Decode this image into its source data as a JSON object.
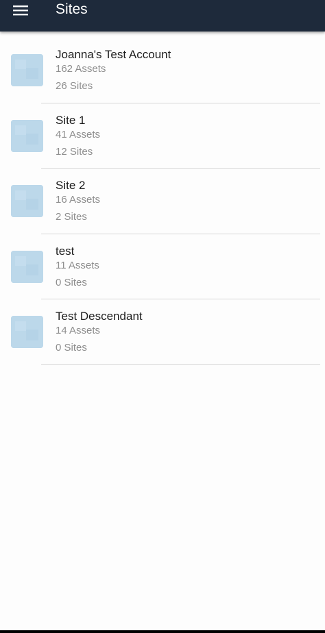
{
  "header": {
    "title": "Sites",
    "menu_icon": "hamburger-menu-icon",
    "background_color": "#1e2a3b"
  },
  "sites": [
    {
      "name": "Joanna's Test Account",
      "assets": "162 Assets",
      "sites": "26 Sites"
    },
    {
      "name": "Site 1",
      "assets": "41 Assets",
      "sites": "12 Sites"
    },
    {
      "name": "Site 2",
      "assets": "16 Assets",
      "sites": "2 Sites"
    },
    {
      "name": "test",
      "assets": "11 Assets",
      "sites": "0 Sites"
    },
    {
      "name": "Test Descendant",
      "assets": "14 Assets",
      "sites": "0 Sites"
    }
  ],
  "colors": {
    "thumbnail": "#bcd8ea",
    "secondary_text": "#8e8e8e"
  }
}
